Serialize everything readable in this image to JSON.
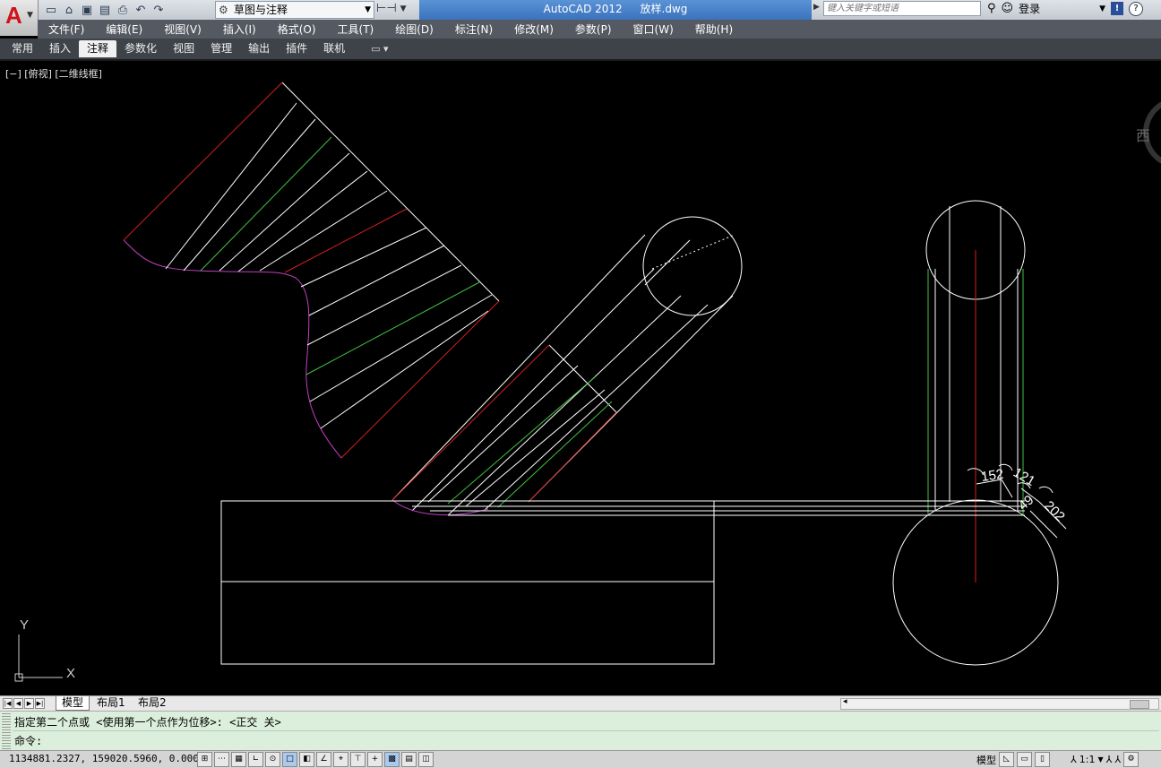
{
  "app": {
    "title": "AutoCAD 2012",
    "file": "放样.dwg",
    "logo_letter": "A"
  },
  "workspace": {
    "label": "草图与注释"
  },
  "search": {
    "placeholder": "键入关键字或短语"
  },
  "account": {
    "login": "登录"
  },
  "menu": [
    "文件(F)",
    "编辑(E)",
    "视图(V)",
    "插入(I)",
    "格式(O)",
    "工具(T)",
    "绘图(D)",
    "标注(N)",
    "修改(M)",
    "参数(P)",
    "窗口(W)",
    "帮助(H)"
  ],
  "ribbon_tabs": [
    "常用",
    "插入",
    "注释",
    "参数化",
    "视图",
    "管理",
    "输出",
    "插件",
    "联机"
  ],
  "ribbon_active": "注释",
  "viewport": {
    "label": "[−] [俯视] [二维线框]",
    "viewcube_label": "西",
    "ucs_x": "X",
    "ucs_y": "Y"
  },
  "dimensions": [
    "152",
    "121",
    "49",
    "202"
  ],
  "layout_tabs": [
    "模型",
    "布局1",
    "布局2"
  ],
  "command": {
    "history": "指定第二个点或 <使用第一个点作为位移>:  <正交 关>",
    "prompt": "命令:"
  },
  "status": {
    "coords": "1134881.2327, 159020.5960, 0.0000",
    "model_label": "模型",
    "scale": "1:1"
  },
  "colors": {
    "accent_title": "#3b72bd",
    "line_white": "#ffffff",
    "line_magenta": "#c040c0",
    "line_red": "#d02020",
    "line_green": "#40c040",
    "command_bg": "#dcefdc"
  }
}
